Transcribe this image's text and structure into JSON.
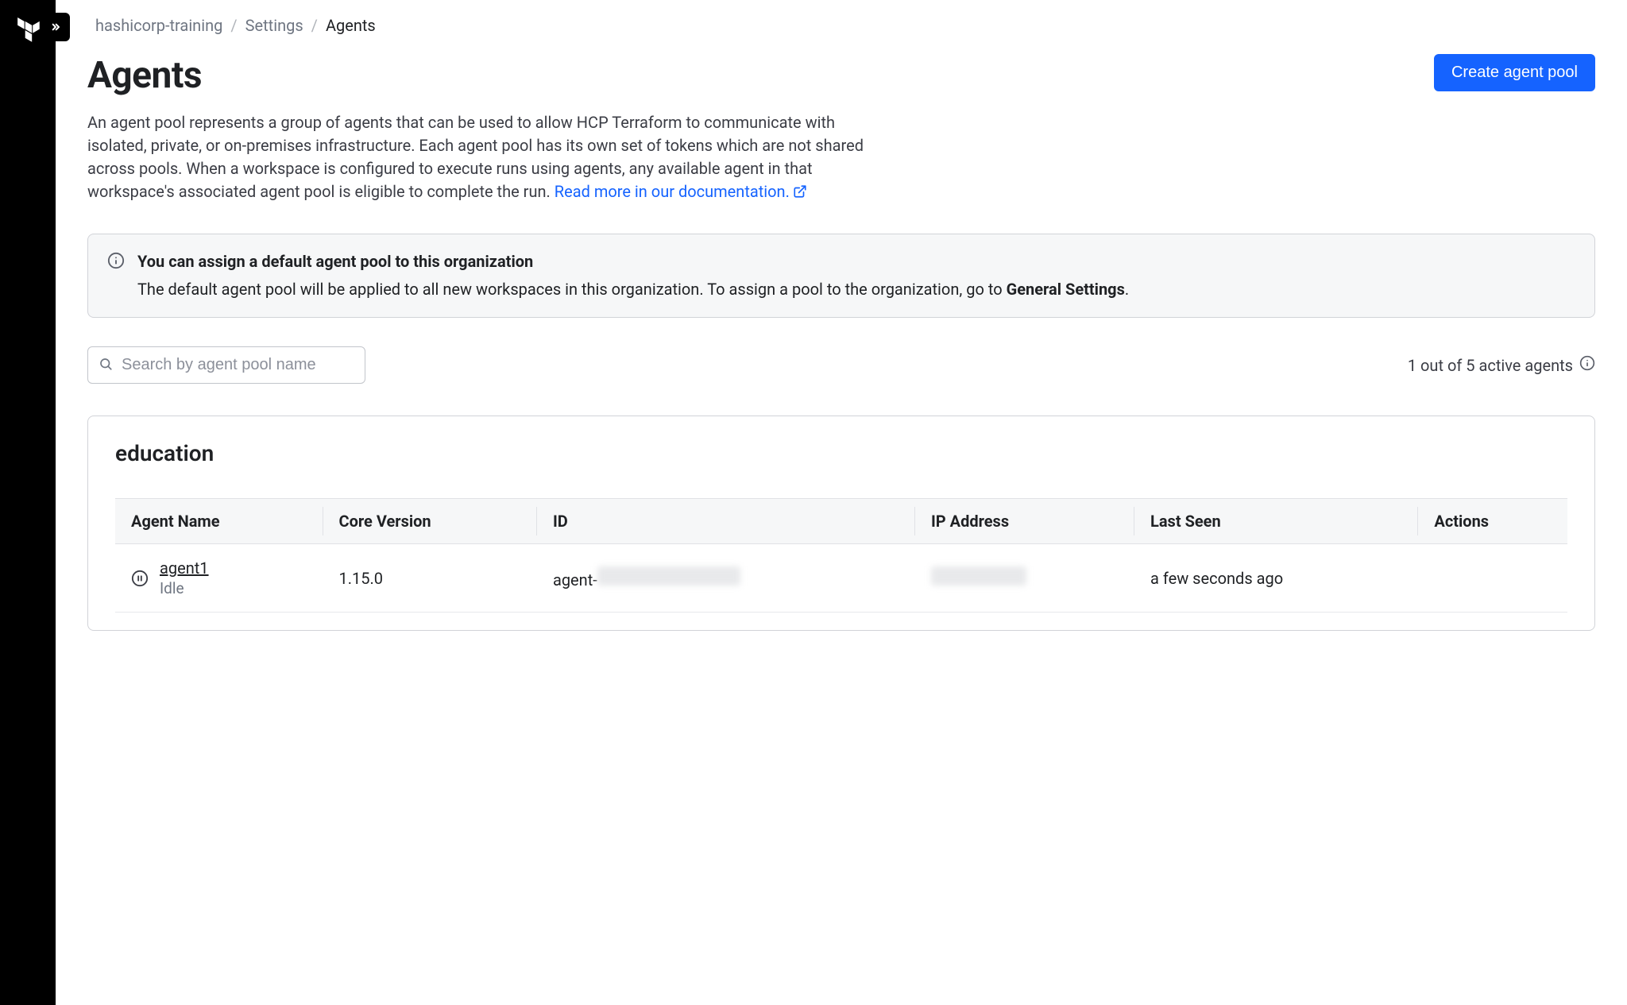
{
  "breadcrumb": {
    "org": "hashicorp-training",
    "section": "Settings",
    "page": "Agents"
  },
  "header": {
    "title": "Agents",
    "create_button": "Create agent pool"
  },
  "description": {
    "text": "An agent pool represents a group of agents that can be used to allow HCP Terraform to communicate with isolated, private, or on-premises infrastructure. Each agent pool has its own set of tokens which are not shared across pools. When a workspace is configured to execute runs using agents, any available agent in that workspace's associated agent pool is eligible to complete the run. ",
    "link_text": "Read more in our documentation."
  },
  "banner": {
    "title": "You can assign a default agent pool to this organization",
    "body_prefix": "The default agent pool will be applied to all new workspaces in this organization. To assign a pool to the organization, go to ",
    "link_text": "General Settings",
    "body_suffix": "."
  },
  "search": {
    "placeholder": "Search by agent pool name"
  },
  "status": {
    "text": "1 out of 5 active agents"
  },
  "pool": {
    "name": "education"
  },
  "table": {
    "columns": {
      "name": "Agent Name",
      "version": "Core Version",
      "id": "ID",
      "ip": "IP Address",
      "last_seen": "Last Seen",
      "actions": "Actions"
    },
    "rows": [
      {
        "name": "agent1",
        "status": "Idle",
        "version": "1.15.0",
        "id_prefix": "agent-",
        "last_seen": "a few seconds ago"
      }
    ]
  }
}
